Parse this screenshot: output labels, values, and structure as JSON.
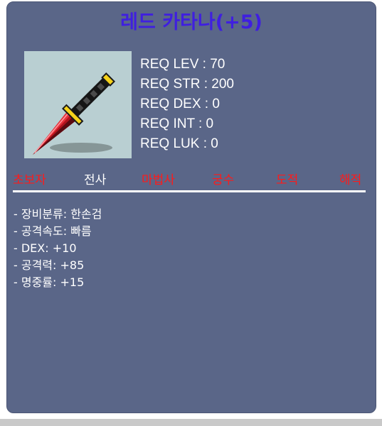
{
  "item": {
    "title": "레드 카타나(+5)",
    "icon": "red-katana-icon"
  },
  "requirements": [
    {
      "text": "REQ LEV : 70"
    },
    {
      "text": "REQ STR : 200"
    },
    {
      "text": "REQ DEX : 0"
    },
    {
      "text": "REQ INT : 0"
    },
    {
      "text": "REQ LUK : 0"
    }
  ],
  "jobs": [
    {
      "label": "초보자",
      "color": "#ff1a1a"
    },
    {
      "label": "전사",
      "color": "#ffffff"
    },
    {
      "label": "마법사",
      "color": "#ff1a1a"
    },
    {
      "label": "궁수",
      "color": "#ff1a1a"
    },
    {
      "label": "도적",
      "color": "#ff1a1a"
    },
    {
      "label": "해적",
      "color": "#ff1a1a"
    }
  ],
  "stats": [
    {
      "text": "- 장비분류: 한손검"
    },
    {
      "text": "- 공격속도: 빠름"
    },
    {
      "text": "- DEX: +10"
    },
    {
      "text": "- 공격력: +85"
    },
    {
      "text": "- 명중률: +15"
    }
  ],
  "colors": {
    "panel_bg": "#5a6688",
    "title": "#3f1fe0",
    "job_available": "#ffffff",
    "job_unavailable": "#ff1a1a"
  }
}
